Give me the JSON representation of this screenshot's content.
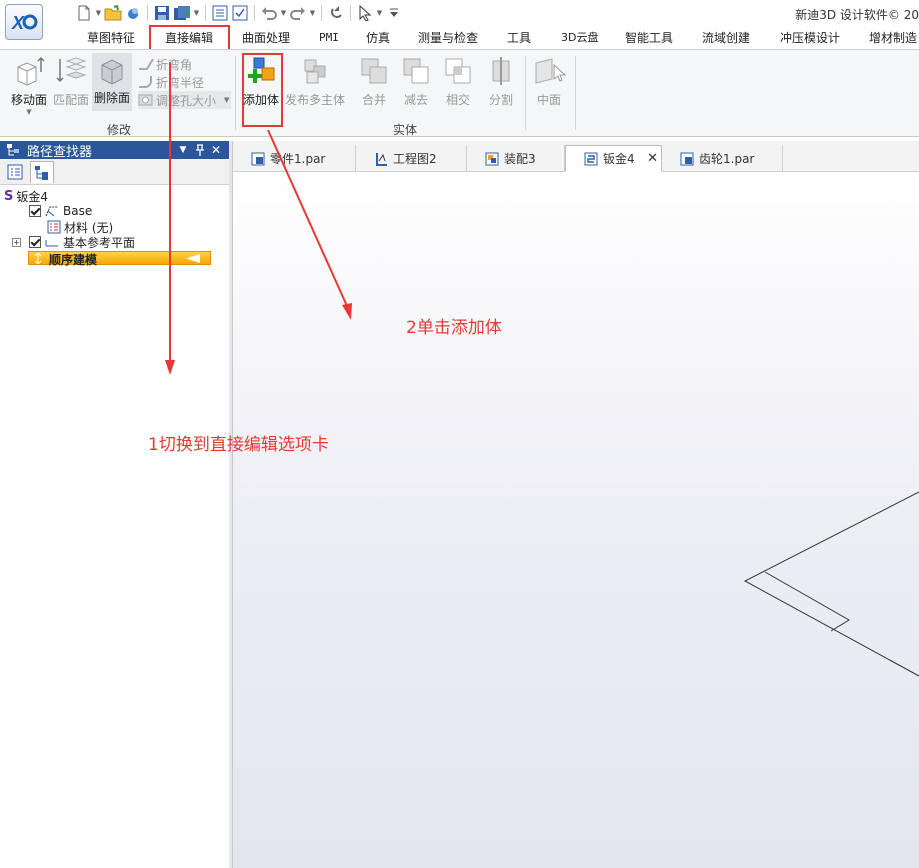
{
  "window": {
    "title": "新迪3D 设计软件© 20"
  },
  "ribbon_tabs": [
    {
      "label": "草图特征"
    },
    {
      "label": "直接编辑"
    },
    {
      "label": "曲面处理"
    },
    {
      "label": "PMI"
    },
    {
      "label": "仿真"
    },
    {
      "label": "测量与检查"
    },
    {
      "label": "工具"
    },
    {
      "label": "3D云盘"
    },
    {
      "label": "智能工具"
    },
    {
      "label": "流域创建"
    },
    {
      "label": "冲压模设计"
    },
    {
      "label": "增材制造"
    }
  ],
  "ribbon": {
    "modify": {
      "move_face": "移动面",
      "match_face": "匹配面",
      "delete_face": "删除面",
      "bend_angle": "折弯角",
      "bend_radius": "折弯半径",
      "resize_hole": "调整孔大小",
      "group_label": "修改"
    },
    "body": {
      "add_body": "添加体",
      "publish_multibody": "发布多主体",
      "union": "合并",
      "subtract": "减去",
      "intersect": "相交",
      "split": "分割",
      "group_label": "实体"
    },
    "midplane": "中面"
  },
  "path_finder": {
    "title": "路径查找器",
    "tree": {
      "root": "钣金4",
      "base": "Base",
      "material": "材料 (无)",
      "ref_planes": "基本参考平面",
      "ordered": "顺序建模"
    }
  },
  "doc_tabs": [
    {
      "label": "零件1.par"
    },
    {
      "label": "工程图2"
    },
    {
      "label": "装配3"
    },
    {
      "label": "钣金4"
    },
    {
      "label": "齿轮1.par"
    }
  ],
  "annotations": {
    "step1": "1切换到直接编辑选项卡",
    "step2": "2单击添加体"
  },
  "colors": {
    "accent_blue": "#2b579a",
    "annotation_red": "#e53935",
    "ordered_bar": "#f6a800"
  }
}
